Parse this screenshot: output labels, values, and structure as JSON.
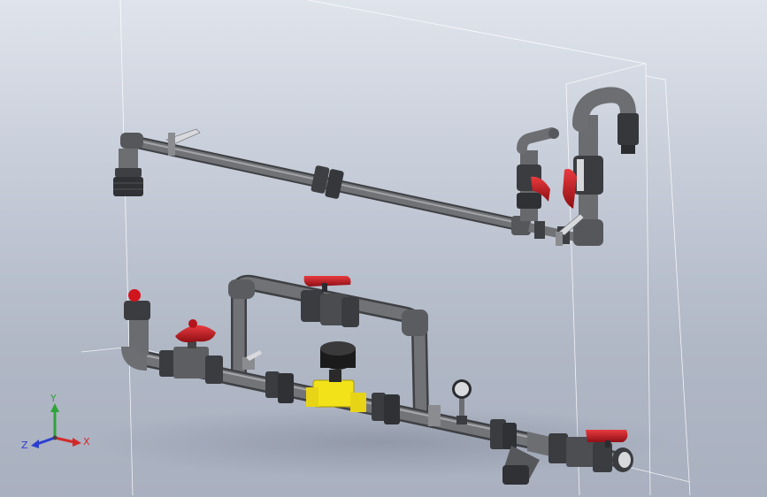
{
  "viewport": {
    "background_top": "#dfe4ec",
    "background_bottom": "#a9b0bf"
  },
  "model": {
    "pipe_color": "#6c6e72",
    "fitting_color": "#4a4c50",
    "handle_color": "#c4161c",
    "solenoid_body_color": "#f2e21a",
    "actuator_color": "#1b1b1b"
  },
  "triad": {
    "x_label": "X",
    "y_label": "Y",
    "z_label": "Z",
    "x_color": "#d22a2a",
    "y_color": "#2ea43a",
    "z_color": "#2a3fcf"
  }
}
